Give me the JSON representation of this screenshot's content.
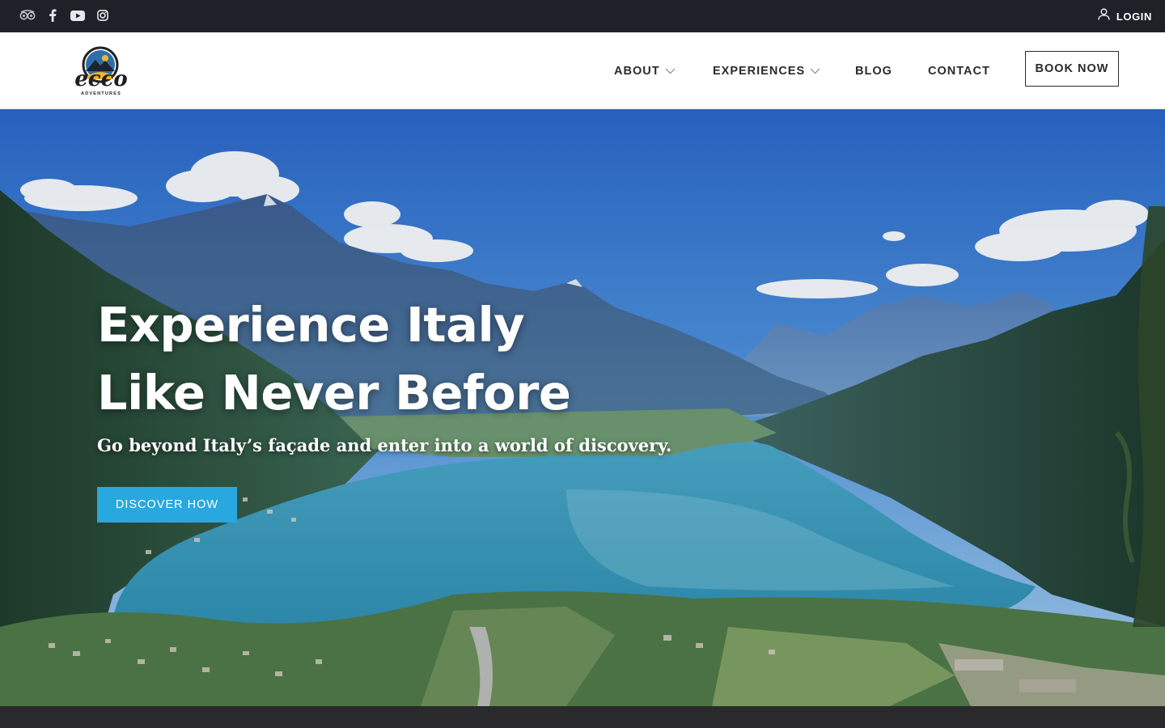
{
  "topbar": {
    "social_icons": [
      "tripadvisor-icon",
      "facebook-icon",
      "youtube-icon",
      "instagram-icon"
    ],
    "login_label": "LOGIN"
  },
  "header": {
    "logo_text": "ecco",
    "logo_subtext": "ADVENTURES",
    "nav": [
      {
        "label": "ABOUT",
        "has_dropdown": true
      },
      {
        "label": "EXPERIENCES",
        "has_dropdown": true
      },
      {
        "label": "BLOG",
        "has_dropdown": false
      },
      {
        "label": "CONTACT",
        "has_dropdown": false
      }
    ],
    "book_label": "BOOK NOW"
  },
  "hero": {
    "headline_line1": "Experience Italy",
    "headline_line2": "Like Never Before",
    "subheadline": "Go beyond Italy’s façade and enter into a world of discovery.",
    "cta_label": "DISCOVER HOW"
  },
  "colors": {
    "topbar_bg": "#1f2128",
    "cta_bg": "#29a7df",
    "nav_text": "#2b2b2b",
    "footer_bg": "#2a2a2c"
  }
}
